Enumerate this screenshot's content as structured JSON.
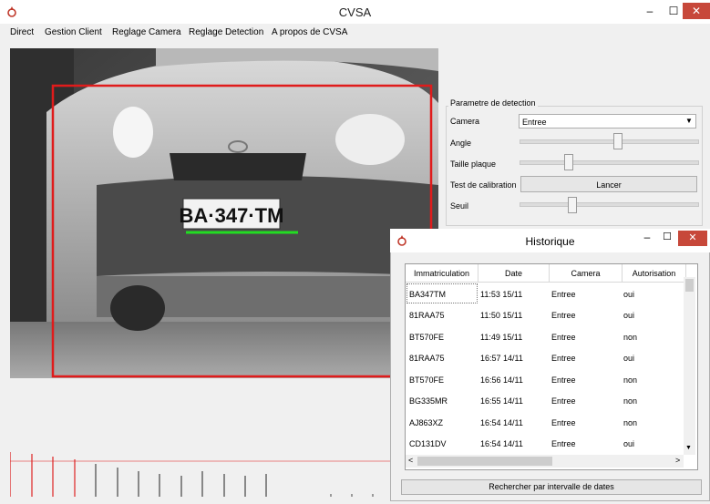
{
  "window": {
    "title": "CVSA",
    "min_label": "–",
    "max_label": "☐",
    "close_label": "✕"
  },
  "menu": [
    "Direct",
    "Gestion Client",
    "Reglage Camera",
    "Reglage Detection",
    "A propos de CVSA"
  ],
  "camera": {
    "plate_text": "BA·347·TM"
  },
  "params": {
    "title": "Parametre de detection",
    "camera_label": "Camera",
    "camera_value": "Entree",
    "angle_label": "Angle",
    "angle_level": 0.55,
    "taille_label": "Taille plaque",
    "taille_level": 0.27,
    "test_label": "Test de calibration",
    "test_button": "Lancer",
    "seuil_label": "Seuil",
    "seuil_level": 0.29
  },
  "historique": {
    "title": "Historique",
    "columns": [
      "Immatriculation",
      "Date",
      "Camera",
      "Autorisation"
    ],
    "rows": [
      [
        "BA347TM",
        "11:53 15/11",
        "Entree",
        "oui"
      ],
      [
        "81RAA75",
        "11:50 15/11",
        "Entree",
        "oui"
      ],
      [
        "BT570FE",
        "11:49 15/11",
        "Entree",
        "non"
      ],
      [
        "81RAA75",
        "16:57 14/11",
        "Entree",
        "oui"
      ],
      [
        "BT570FE",
        "16:56 14/11",
        "Entree",
        "non"
      ],
      [
        "BG335MR",
        "16:55 14/11",
        "Entree",
        "non"
      ],
      [
        "AJ863XZ",
        "16:54 14/11",
        "Entree",
        "non"
      ],
      [
        "CD131DV",
        "16:54 14/11",
        "Entree",
        "oui"
      ]
    ],
    "search_button": "Rechercher par intervalle de dates",
    "scroll_left": "<",
    "scroll_right": ">"
  }
}
